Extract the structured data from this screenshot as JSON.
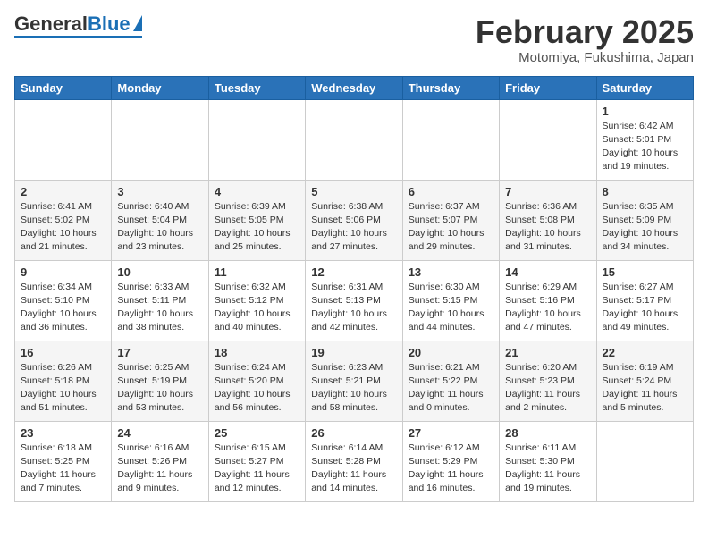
{
  "logo": {
    "general": "General",
    "blue": "Blue"
  },
  "header": {
    "month": "February 2025",
    "location": "Motomiya, Fukushima, Japan"
  },
  "weekdays": [
    "Sunday",
    "Monday",
    "Tuesday",
    "Wednesday",
    "Thursday",
    "Friday",
    "Saturday"
  ],
  "weeks": [
    [
      {
        "day": "",
        "info": ""
      },
      {
        "day": "",
        "info": ""
      },
      {
        "day": "",
        "info": ""
      },
      {
        "day": "",
        "info": ""
      },
      {
        "day": "",
        "info": ""
      },
      {
        "day": "",
        "info": ""
      },
      {
        "day": "1",
        "info": "Sunrise: 6:42 AM\nSunset: 5:01 PM\nDaylight: 10 hours\nand 19 minutes."
      }
    ],
    [
      {
        "day": "2",
        "info": "Sunrise: 6:41 AM\nSunset: 5:02 PM\nDaylight: 10 hours\nand 21 minutes."
      },
      {
        "day": "3",
        "info": "Sunrise: 6:40 AM\nSunset: 5:04 PM\nDaylight: 10 hours\nand 23 minutes."
      },
      {
        "day": "4",
        "info": "Sunrise: 6:39 AM\nSunset: 5:05 PM\nDaylight: 10 hours\nand 25 minutes."
      },
      {
        "day": "5",
        "info": "Sunrise: 6:38 AM\nSunset: 5:06 PM\nDaylight: 10 hours\nand 27 minutes."
      },
      {
        "day": "6",
        "info": "Sunrise: 6:37 AM\nSunset: 5:07 PM\nDaylight: 10 hours\nand 29 minutes."
      },
      {
        "day": "7",
        "info": "Sunrise: 6:36 AM\nSunset: 5:08 PM\nDaylight: 10 hours\nand 31 minutes."
      },
      {
        "day": "8",
        "info": "Sunrise: 6:35 AM\nSunset: 5:09 PM\nDaylight: 10 hours\nand 34 minutes."
      }
    ],
    [
      {
        "day": "9",
        "info": "Sunrise: 6:34 AM\nSunset: 5:10 PM\nDaylight: 10 hours\nand 36 minutes."
      },
      {
        "day": "10",
        "info": "Sunrise: 6:33 AM\nSunset: 5:11 PM\nDaylight: 10 hours\nand 38 minutes."
      },
      {
        "day": "11",
        "info": "Sunrise: 6:32 AM\nSunset: 5:12 PM\nDaylight: 10 hours\nand 40 minutes."
      },
      {
        "day": "12",
        "info": "Sunrise: 6:31 AM\nSunset: 5:13 PM\nDaylight: 10 hours\nand 42 minutes."
      },
      {
        "day": "13",
        "info": "Sunrise: 6:30 AM\nSunset: 5:15 PM\nDaylight: 10 hours\nand 44 minutes."
      },
      {
        "day": "14",
        "info": "Sunrise: 6:29 AM\nSunset: 5:16 PM\nDaylight: 10 hours\nand 47 minutes."
      },
      {
        "day": "15",
        "info": "Sunrise: 6:27 AM\nSunset: 5:17 PM\nDaylight: 10 hours\nand 49 minutes."
      }
    ],
    [
      {
        "day": "16",
        "info": "Sunrise: 6:26 AM\nSunset: 5:18 PM\nDaylight: 10 hours\nand 51 minutes."
      },
      {
        "day": "17",
        "info": "Sunrise: 6:25 AM\nSunset: 5:19 PM\nDaylight: 10 hours\nand 53 minutes."
      },
      {
        "day": "18",
        "info": "Sunrise: 6:24 AM\nSunset: 5:20 PM\nDaylight: 10 hours\nand 56 minutes."
      },
      {
        "day": "19",
        "info": "Sunrise: 6:23 AM\nSunset: 5:21 PM\nDaylight: 10 hours\nand 58 minutes."
      },
      {
        "day": "20",
        "info": "Sunrise: 6:21 AM\nSunset: 5:22 PM\nDaylight: 11 hours\nand 0 minutes."
      },
      {
        "day": "21",
        "info": "Sunrise: 6:20 AM\nSunset: 5:23 PM\nDaylight: 11 hours\nand 2 minutes."
      },
      {
        "day": "22",
        "info": "Sunrise: 6:19 AM\nSunset: 5:24 PM\nDaylight: 11 hours\nand 5 minutes."
      }
    ],
    [
      {
        "day": "23",
        "info": "Sunrise: 6:18 AM\nSunset: 5:25 PM\nDaylight: 11 hours\nand 7 minutes."
      },
      {
        "day": "24",
        "info": "Sunrise: 6:16 AM\nSunset: 5:26 PM\nDaylight: 11 hours\nand 9 minutes."
      },
      {
        "day": "25",
        "info": "Sunrise: 6:15 AM\nSunset: 5:27 PM\nDaylight: 11 hours\nand 12 minutes."
      },
      {
        "day": "26",
        "info": "Sunrise: 6:14 AM\nSunset: 5:28 PM\nDaylight: 11 hours\nand 14 minutes."
      },
      {
        "day": "27",
        "info": "Sunrise: 6:12 AM\nSunset: 5:29 PM\nDaylight: 11 hours\nand 16 minutes."
      },
      {
        "day": "28",
        "info": "Sunrise: 6:11 AM\nSunset: 5:30 PM\nDaylight: 11 hours\nand 19 minutes."
      },
      {
        "day": "",
        "info": ""
      }
    ]
  ]
}
